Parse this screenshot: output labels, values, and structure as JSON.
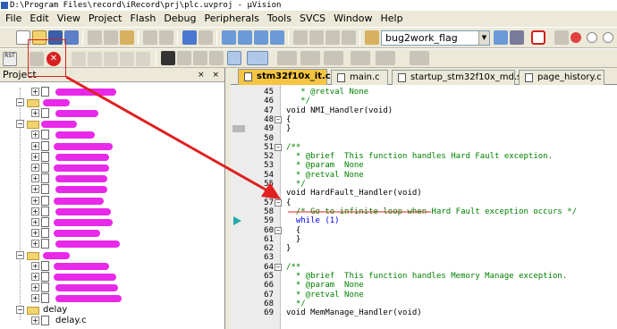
{
  "window": {
    "title": "D:\\Program Files\\record\\iRecord\\prj\\plc.uvproj - µVision"
  },
  "menu": [
    "File",
    "Edit",
    "View",
    "Project",
    "Flash",
    "Debug",
    "Peripherals",
    "Tools",
    "SVCS",
    "Window",
    "Help"
  ],
  "toolbar": {
    "target_combo": "bug2work_flag"
  },
  "project_panel": {
    "title": "Project",
    "pin_buttons": "× ×",
    "folder_label": "delay",
    "file_label": "delay.c"
  },
  "tabs": [
    {
      "label": "stm32f10x_it.c",
      "active": true
    },
    {
      "label": "main.c",
      "active": false
    },
    {
      "label": "startup_stm32f10x_md.s",
      "active": false
    },
    {
      "label": "page_history.c",
      "active": false
    }
  ],
  "code": [
    {
      "n": "45",
      "t": "   * @retval None",
      "c": "cmt",
      "fold": "",
      "mark": ""
    },
    {
      "n": "46",
      "t": "   */",
      "c": "cmt",
      "fold": "",
      "mark": ""
    },
    {
      "n": "47",
      "t": "void NMI_Handler(void)",
      "c": "",
      "fold": "",
      "mark": ""
    },
    {
      "n": "48",
      "t": "{",
      "c": "",
      "fold": "-",
      "mark": ""
    },
    {
      "n": "49",
      "t": "}",
      "c": "",
      "fold": "",
      "mark": "bp"
    },
    {
      "n": "50",
      "t": "",
      "c": "",
      "fold": "",
      "mark": ""
    },
    {
      "n": "51",
      "t": "/**",
      "c": "cmt",
      "fold": "-",
      "mark": ""
    },
    {
      "n": "52",
      "t": "  * @brief  This function handles Hard Fault exception.",
      "c": "cmt",
      "fold": "",
      "mark": ""
    },
    {
      "n": "53",
      "t": "  * @param  None",
      "c": "cmt",
      "fold": "",
      "mark": ""
    },
    {
      "n": "54",
      "t": "  * @retval None",
      "c": "cmt",
      "fold": "",
      "mark": ""
    },
    {
      "n": "55",
      "t": "  */",
      "c": "cmt",
      "fold": "",
      "mark": ""
    },
    {
      "n": "56",
      "t": "void HardFault_Handler(void)",
      "c": "",
      "fold": "",
      "mark": ""
    },
    {
      "n": "57",
      "t": "{",
      "c": "",
      "fold": "-",
      "mark": ""
    },
    {
      "n": "58",
      "t": "  /* Go to infinite loop when Hard Fault exception occurs */",
      "c": "cmt",
      "fold": "",
      "mark": ""
    },
    {
      "n": "59",
      "t": "  while (1)",
      "c": "kw",
      "fold": "",
      "mark": "arrow"
    },
    {
      "n": "60",
      "t": "  {",
      "c": "",
      "fold": "-",
      "mark": ""
    },
    {
      "n": "61",
      "t": "  }",
      "c": "",
      "fold": "",
      "mark": ""
    },
    {
      "n": "62",
      "t": "}",
      "c": "",
      "fold": "",
      "mark": ""
    },
    {
      "n": "63",
      "t": "",
      "c": "",
      "fold": "",
      "mark": ""
    },
    {
      "n": "64",
      "t": "/**",
      "c": "cmt",
      "fold": "-",
      "mark": ""
    },
    {
      "n": "65",
      "t": "  * @brief  This function handles Memory Manage exception.",
      "c": "cmt",
      "fold": "",
      "mark": ""
    },
    {
      "n": "66",
      "t": "  * @param  None",
      "c": "cmt",
      "fold": "",
      "mark": ""
    },
    {
      "n": "67",
      "t": "  * @retval None",
      "c": "cmt",
      "fold": "",
      "mark": ""
    },
    {
      "n": "68",
      "t": "  */",
      "c": "cmt",
      "fold": "",
      "mark": ""
    },
    {
      "n": "69",
      "t": "void MemManage_Handler(void)",
      "c": "",
      "fold": "",
      "mark": ""
    }
  ],
  "colors": {
    "annotation": "#e02020",
    "redaction": "#e81ee8",
    "active_tab": "#f5c542"
  }
}
